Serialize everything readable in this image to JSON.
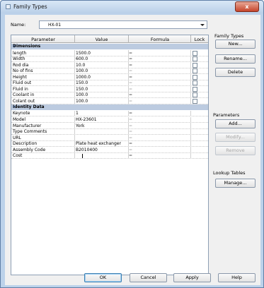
{
  "window": {
    "title": "Family Types",
    "close_label": "x"
  },
  "name_field": {
    "label": "Name:",
    "value": "HX-01"
  },
  "grid": {
    "columns": [
      "Parameter",
      "Value",
      "Formula",
      "Lock"
    ],
    "groups": [
      {
        "title": "Dimensions",
        "collapse_icon": "»",
        "rows": [
          {
            "param": "length",
            "value": "1500.0",
            "formula": "=",
            "eq_grey": false
          },
          {
            "param": "Width",
            "value": "600.0",
            "formula": "=",
            "eq_grey": false
          },
          {
            "param": "Rod dia",
            "value": "10.0",
            "formula": "=",
            "eq_grey": false
          },
          {
            "param": "No of fins",
            "value": "100.0",
            "formula": "=",
            "eq_grey": true
          },
          {
            "param": "Height",
            "value": "1000.0",
            "formula": "=",
            "eq_grey": false
          },
          {
            "param": "Fluid out",
            "value": "150.0",
            "formula": "=",
            "eq_grey": true
          },
          {
            "param": "Fluid in",
            "value": "150.0",
            "formula": "=",
            "eq_grey": true
          },
          {
            "param": "Coolant in",
            "value": "100.0",
            "formula": "=",
            "eq_grey": false
          },
          {
            "param": "Colant out",
            "value": "100.0",
            "formula": "=",
            "eq_grey": true
          }
        ]
      },
      {
        "title": "Identity Data",
        "collapse_icon": "»",
        "rows": [
          {
            "param": "Keynote",
            "value": "1",
            "formula": "=",
            "eq_grey": false
          },
          {
            "param": "Model",
            "value": "HX-23601",
            "formula": "=",
            "eq_grey": true
          },
          {
            "param": "Manufacturer",
            "value": "York",
            "formula": "=",
            "eq_grey": true
          },
          {
            "param": "Type Comments",
            "value": "",
            "formula": "=",
            "eq_grey": true
          },
          {
            "param": "URL",
            "value": "",
            "formula": "=",
            "eq_grey": true
          },
          {
            "param": "Description",
            "value": "Plate heat exchanger",
            "formula": "=",
            "eq_grey": false
          },
          {
            "param": "Assembly Code",
            "value": "B2010400",
            "formula": "=",
            "eq_grey": true
          },
          {
            "param": "Cost",
            "value": "",
            "formula": "=",
            "eq_grey": false
          }
        ]
      }
    ]
  },
  "sidebar": {
    "family_types_label": "Family Types",
    "new_label": "New...",
    "rename_label": "Rename...",
    "delete_label": "Delete",
    "parameters_label": "Parameters",
    "add_label": "Add...",
    "modify_label": "Modify...",
    "remove_label": "Remove",
    "lookup_tables_label": "Lookup Tables",
    "manage_label": "Manage..."
  },
  "footer": {
    "ok_label": "OK",
    "cancel_label": "Cancel",
    "apply_label": "Apply",
    "help_label": "Help"
  }
}
